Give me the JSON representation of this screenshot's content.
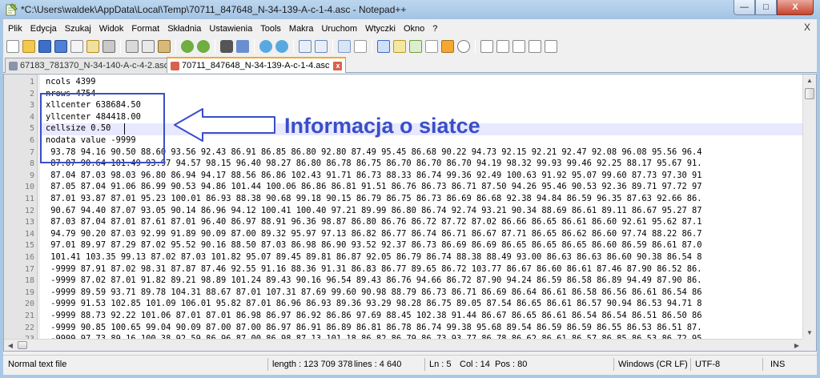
{
  "window": {
    "title": "*C:\\Users\\waldek\\AppData\\Local\\Temp\\70711_847648_N-34-139-A-c-1-4.asc - Notepad++",
    "min_glyph": "—",
    "max_glyph": "□",
    "close_glyph": "X"
  },
  "menu": {
    "items": [
      "Plik",
      "Edycja",
      "Szukaj",
      "Widok",
      "Format",
      "Składnia",
      "Ustawienia",
      "Tools",
      "Makra",
      "Uruchom",
      "Wtyczki",
      "Okno",
      "?"
    ],
    "close_glyph": "X"
  },
  "tabs": [
    {
      "label": "67183_781370_N-34-140-A-c-4-2.asc",
      "active": false
    },
    {
      "label": "70711_847648_N-34-139-A-c-1-4.asc",
      "active": true
    }
  ],
  "editor": {
    "line_numbers": [
      "1",
      "2",
      "3",
      "4",
      "5",
      "6",
      "7",
      "8",
      "9",
      "10",
      "11",
      "12",
      "13",
      "14",
      "15",
      "16",
      "17",
      "18",
      "19",
      "20",
      "21",
      "22",
      "23"
    ],
    "lines": [
      "ncols 4399",
      "nrows 4754",
      "xllcenter 638684.50",
      "yllcenter 484418.00",
      "cellsize 0.50",
      "nodata value -9999",
      " 93.78 94.16 90.50 88.60 93.56 92.43 86.91 86.85 86.80 92.80 87.49 95.45 86.68 90.22 94.73 92.15 92.21 92.47 92.08 96.08 95.56 96.4",
      " 87.07 90.64 101.49 93.97 94.57 98.15 96.40 98.27 86.80 86.78 86.75 86.70 86.70 86.70 94.19 98.32 99.93 99.46 92.25 88.17 95.67 91.",
      " 87.04 87.03 98.03 96.80 86.94 94.17 88.56 86.86 102.43 91.71 86.73 88.33 86.74 99.36 92.49 100.63 91.92 95.07 99.60 87.73 97.30 91",
      " 87.05 87.04 91.06 86.99 90.53 94.86 101.44 100.06 86.86 86.81 91.51 86.76 86.73 86.71 87.50 94.26 95.46 90.53 92.36 89.71 97.72 97",
      " 87.01 93.87 87.01 95.23 100.01 86.93 88.38 90.68 99.18 90.15 86.79 86.75 86.73 86.69 86.68 92.38 94.84 86.59 96.35 87.63 92.66 86.",
      " 90.67 94.40 87.07 93.05 90.14 86.96 94.12 100.41 100.40 97.21 89.99 86.80 86.74 92.74 93.21 90.34 88.69 86.61 89.11 86.67 95.27 87",
      " 87.03 87.04 87.01 87.61 87.01 96.40 86.97 88.91 96.36 98.87 86.80 86.76 86.72 87.72 87.02 86.66 86.65 86.61 86.60 92.61 95.62 87.1",
      " 94.79 90.20 87.03 92.99 91.89 90.09 87.00 89.32 95.97 97.13 86.82 86.77 86.74 86.71 86.67 87.71 86.65 86.62 86.60 97.74 88.22 86.7",
      " 97.01 89.97 87.29 87.02 95.52 90.16 88.50 87.03 86.98 86.90 93.52 92.37 86.73 86.69 86.69 86.65 86.65 86.65 86.60 86.59 86.61 87.0",
      " 101.41 103.35 99.13 87.02 87.03 101.82 95.07 89.45 89.81 86.87 92.05 86.79 86.74 88.38 88.49 93.00 86.63 86.63 86.60 90.38 86.54 8",
      " -9999 87.91 87.02 98.31 87.87 87.46 92.55 91.16 88.36 91.31 86.83 86.77 89.65 86.72 103.77 86.67 86.60 86.61 87.46 87.90 86.52 86.",
      " -9999 87.02 87.01 91.82 89.21 98.89 101.24 89.43 90.16 96.54 89.43 86.76 94.66 86.72 87.90 94.24 86.59 86.58 86.89 94.49 87.90 86.",
      " -9999 89.59 93.71 89.78 104.31 88.67 87.01 107.31 87.69 99.60 90.98 88.79 86.73 86.71 86.69 86.64 86.61 86.58 86.56 86.61 86.54 86",
      " -9999 91.53 102.85 101.09 106.01 95.82 87.01 86.96 86.93 89.36 93.29 98.28 86.75 89.05 87.54 86.65 86.61 86.57 90.94 86.53 94.71 8",
      " -9999 88.73 92.22 101.06 87.01 87.01 86.98 86.97 86.92 86.86 97.69 88.45 102.38 91.44 86.67 86.65 86.61 86.54 86.54 86.51 86.50 86",
      " -9999 90.85 100.65 99.04 90.09 87.00 87.00 86.97 86.91 86.89 86.81 86.78 86.74 99.38 95.68 89.54 86.59 86.59 86.55 86.53 86.51 87.",
      " -9999 97.73 89.16 100.38 92.59 86.96 87.00 86.98 87.13 101.18 86.82 86.79 86.73 93.77 86.78 86.62 86.61 86.57 86.85 86.53 86.72 95"
    ]
  },
  "annotation": {
    "text": "Informacja o siatce"
  },
  "status": {
    "file_type": "Normal text file",
    "length": "length : 123 709 378",
    "lines": "lines : 4 640",
    "ln": "Ln : 5",
    "col": "Col : 14",
    "pos": "Pos : 80",
    "eol": "Windows (CR LF)",
    "encoding": "UTF-8",
    "mode": "INS"
  },
  "colors": {
    "annotation": "#3a4ec8",
    "current_line": "#e8e8ff",
    "active_tab_accent": "#f3a830"
  }
}
